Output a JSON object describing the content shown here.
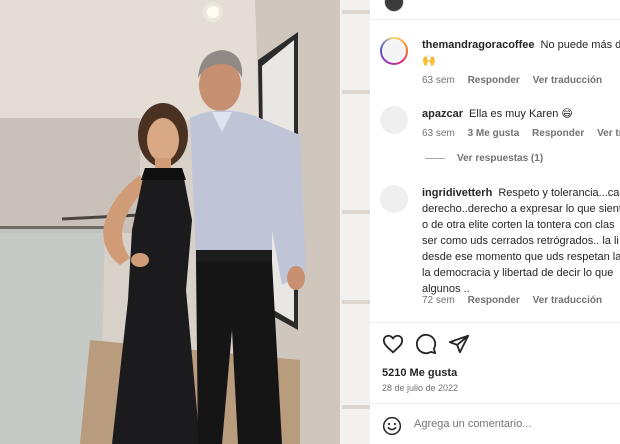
{
  "post_header": {
    "username": "",
    "follow_label": ""
  },
  "comments": [
    {
      "username": "themandragoracoffee",
      "lines": [
        "No puede más de",
        "🙌"
      ],
      "time": "63 sem",
      "likes": "",
      "reply": "Responder",
      "translate": "Ver traducción"
    },
    {
      "username": "apazcar",
      "lines": [
        "Ella es muy Karen 😄"
      ],
      "time": "63 sem",
      "likes": "3 Me gusta",
      "reply": "Responder",
      "translate": "Ver traduc"
    },
    {
      "username": "ingridivetterh",
      "lines": [
        "Respeto y tolerancia...cad",
        "derecho..derecho a expresar lo que sient",
        "o de otra elite corten la tontera con clas",
        "ser como uds cerrados retrógrados.. la li",
        "desde ese momento que uds respetan la",
        "la democracia y libertad de decir lo que",
        "algunos .."
      ],
      "time": "72 sem",
      "likes": "",
      "reply": "Responder",
      "translate": "Ver traducción"
    }
  ],
  "view_replies": "Ver respuestas (1)",
  "actions": {
    "like_icon": "heart-icon",
    "comment_icon": "comment-icon",
    "share_icon": "share-icon"
  },
  "likes_count": "5210 Me gusta",
  "post_date": "28 de julio de 2022",
  "add_comment": {
    "placeholder": "Agrega un comentario...",
    "emoji_icon": "emoji-icon"
  },
  "colors": {
    "link": "#0095f6",
    "muted": "#737373",
    "text": "#262626"
  }
}
